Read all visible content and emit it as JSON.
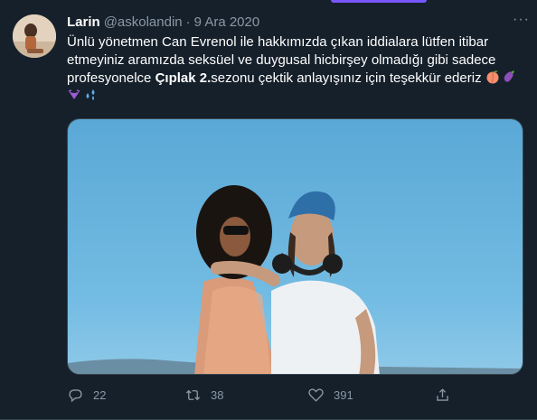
{
  "tweet": {
    "author_name": "Larin",
    "author_handle": "@askolandin",
    "separator": "·",
    "date": "9 Ara 2020",
    "more_label": "···",
    "text_part1": "Ünlü yönetmen Can Evrenol ile hakkımızda çıkan iddialara lütfen itibar etmeyiniz aramızda seksüel ve duygusal hicbirşey olmadığı gibi sadece profesyonelce ",
    "text_bold": "Çıplak 2.",
    "text_part2": "sezonu çektik  anlayışınız için teşekkür ederiz ",
    "emojis": [
      "peach-emoji",
      "eggplant-emoji",
      "bikini-emoji",
      "sweat-droplets-emoji"
    ]
  },
  "actions": {
    "reply_count": "22",
    "retweet_count": "38",
    "like_count": "391"
  },
  "colors": {
    "background": "#15202b",
    "text": "#ffffff",
    "muted": "#8b98a5",
    "accent": "#7856ff",
    "sky": "#5aa8d6"
  }
}
